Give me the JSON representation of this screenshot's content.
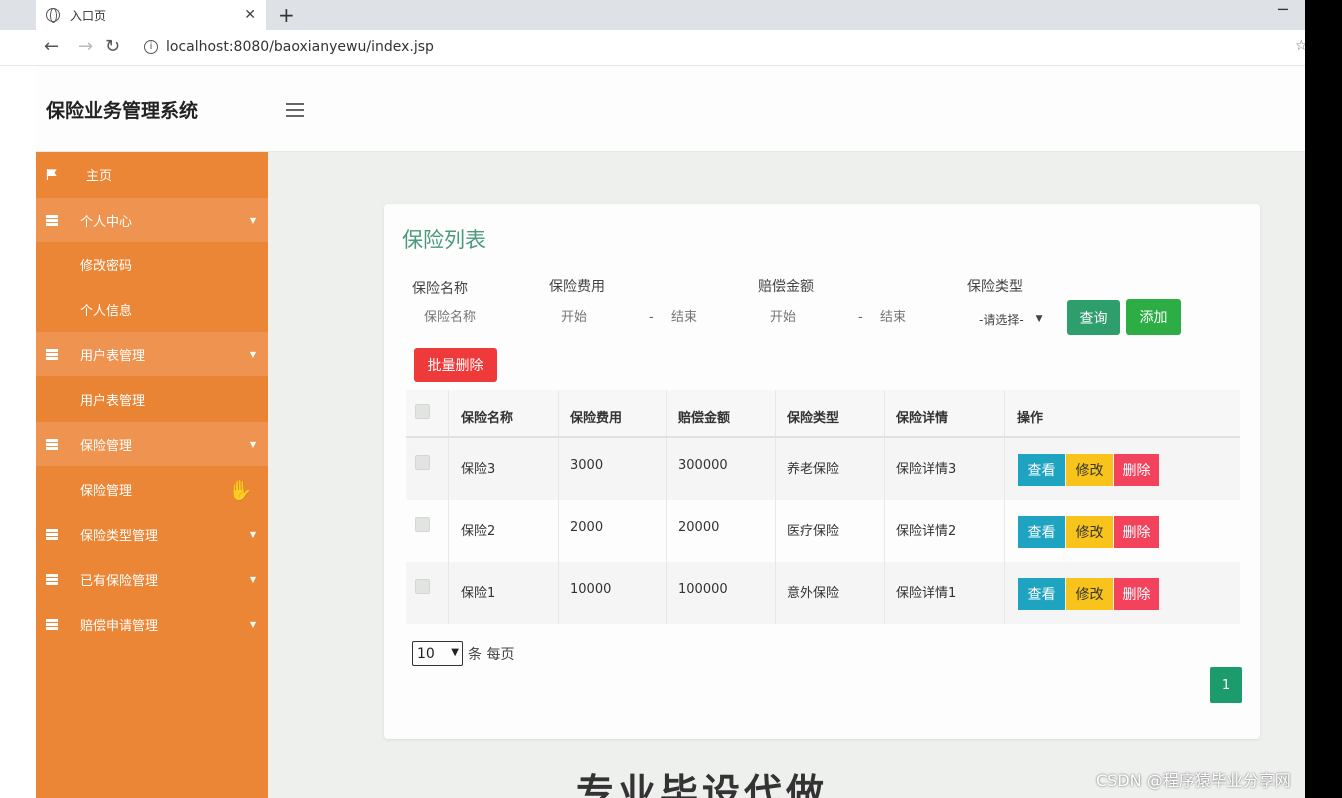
{
  "browser": {
    "tab_title": "入口页",
    "url": "localhost:8080/baoxianyewu/index.jsp",
    "tab_close": "✕",
    "new_tab": "+",
    "minimize": "─"
  },
  "app": {
    "title": "保险业务管理系统"
  },
  "sidebar": {
    "items": [
      {
        "label": "主页",
        "type": "item",
        "icon": "flag-icon"
      },
      {
        "label": "个人中心",
        "type": "group",
        "icon": "grid-icon"
      },
      {
        "label": "修改密码",
        "type": "sub"
      },
      {
        "label": "个人信息",
        "type": "sub"
      },
      {
        "label": "用户表管理",
        "type": "group",
        "icon": "grid-icon"
      },
      {
        "label": "用户表管理",
        "type": "sub"
      },
      {
        "label": "保险管理",
        "type": "group",
        "icon": "grid-icon"
      },
      {
        "label": "保险管理",
        "type": "sub"
      },
      {
        "label": "保险类型管理",
        "type": "group",
        "icon": "grid-icon"
      },
      {
        "label": "已有保险管理",
        "type": "group",
        "icon": "grid-icon"
      },
      {
        "label": "赔偿申请管理",
        "type": "group",
        "icon": "grid-icon"
      }
    ]
  },
  "card": {
    "title": "保险列表",
    "filters": {
      "name_label": "保险名称",
      "name_placeholder": "保险名称",
      "fee_label": "保险费用",
      "fee_start": "开始",
      "fee_end": "结束",
      "comp_label": "赔偿金额",
      "comp_start": "开始",
      "comp_end": "结束",
      "type_label": "保险类型",
      "type_selected": "-请选择-",
      "dash": "-"
    },
    "buttons": {
      "query": "查询",
      "add": "添加",
      "batch_delete": "批量删除"
    },
    "table": {
      "headers": [
        "保险名称",
        "保险费用",
        "赔偿金额",
        "保险类型",
        "保险详情",
        "操作"
      ],
      "rows": [
        [
          "保险3",
          "3000",
          "300000",
          "养老保险",
          "保险详情3"
        ],
        [
          "保险2",
          "2000",
          "20000",
          "医疗保险",
          "保险详情2"
        ],
        [
          "保险1",
          "10000",
          "100000",
          "意外保险",
          "保险详情1"
        ]
      ],
      "actions": {
        "view": "查看",
        "edit": "修改",
        "delete": "删除"
      }
    },
    "pagination": {
      "page_size": "10",
      "per_page_text": "条 每页",
      "current_page": "1"
    }
  },
  "footer_heading": "专业毕设代做",
  "watermark": "CSDN @程序猿毕业分享网",
  "colors": {
    "sidebar": "#ec8637",
    "title_green": "#4a9a7a",
    "query": "#2e9e6d",
    "add": "#2cae45",
    "batch_delete": "#ee3a3a",
    "view": "#1ea3c0",
    "edit": "#f8c31b",
    "delete": "#f2425c"
  }
}
